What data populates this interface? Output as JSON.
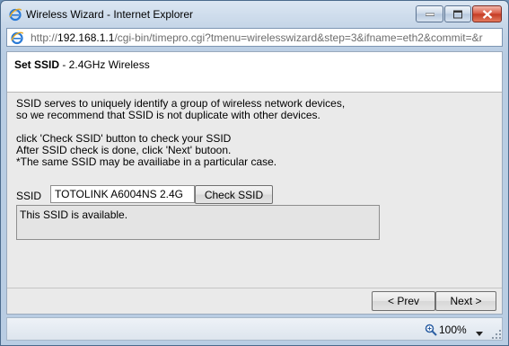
{
  "window": {
    "title": "Wireless Wizard - Internet Explorer"
  },
  "address": {
    "prefix": "http://",
    "host": "192.168.1.1",
    "path": "/cgi-bin/timepro.cgi?tmenu=wirelesswizard&step=3&ifname=eth2&commit=&r"
  },
  "header": {
    "title_bold": "Set SSID",
    "title_rest": " - 2.4GHz Wireless"
  },
  "description": [
    "SSID serves to uniquely identify a group of wireless network devices,",
    "so we recommend that SSID is not duplicate with other devices.",
    "",
    "click 'Check SSID' button to check your SSID",
    "After SSID check is done, click 'Next' butoon.",
    "*The same SSID may be availiabe in a particular case."
  ],
  "ssid": {
    "label": "SSID",
    "value": "TOTOLINK A6004NS 2.4G",
    "check_button": "Check SSID",
    "result": "This SSID is available."
  },
  "nav": {
    "prev": "< Prev",
    "next": "Next >"
  },
  "status": {
    "zoom": "100%"
  },
  "colors": {
    "titlebar": "#c6d6e8",
    "content_bg": "#eaeaea",
    "close_button": "#c23a22"
  }
}
